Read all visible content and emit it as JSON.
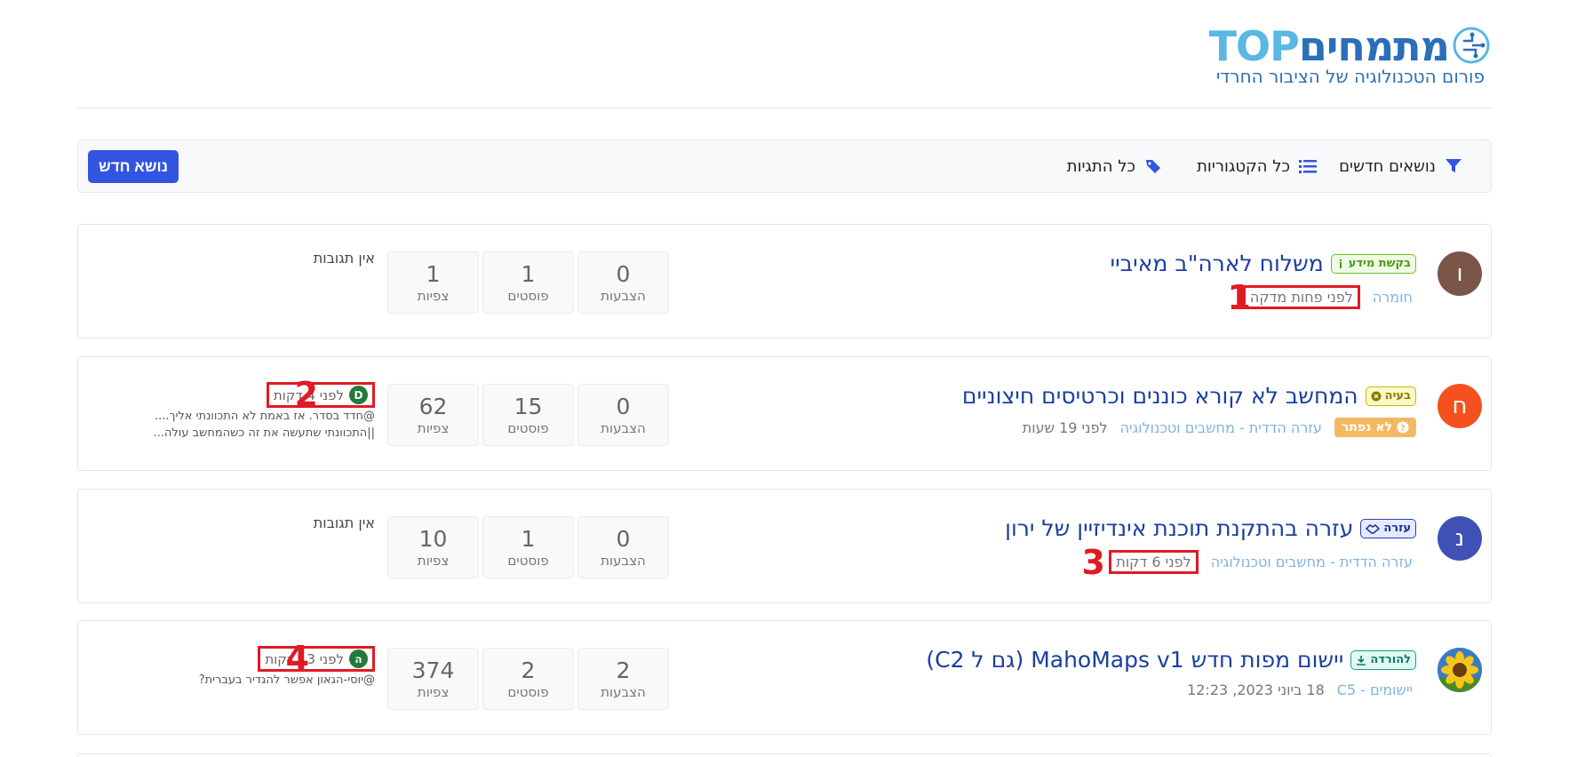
{
  "logo": {
    "main_heb": "מתמחים",
    "main_top": "TOP",
    "subtitle": "פורום הטכנולוגיה של הציבור החרדי"
  },
  "toolbar": {
    "new_topics": "נושאים חדשים",
    "all_categories": "כל הקטגוריות",
    "all_tags": "כל התגיות",
    "new_topic_button": "נושא חדש"
  },
  "stat_labels": {
    "votes": "הצבעות",
    "posts": "פוסטים",
    "views": "צפיות"
  },
  "topics": [
    {
      "avatar_letter": "ו",
      "avatar_color": "#7b5548",
      "badge": "בקשת מידע",
      "title": "משלוח לארה\"ב מאיביי",
      "category": "חומרה",
      "time": "לפני פחות מדקה",
      "votes": "0",
      "posts": "1",
      "views": "1",
      "no_replies": "אין תגובות",
      "marker": "1"
    },
    {
      "avatar_letter": "ח",
      "avatar_color": "#f4511e",
      "badge": "בעיה",
      "title": "המחשב לא קורא כוננים וכרטיסים חיצוניים",
      "status": "לא נפתר",
      "category": "עזרה הדדית - מחשבים וטכנולוגיה",
      "time": "לפני 19 שעות",
      "votes": "0",
      "posts": "15",
      "views": "62",
      "teaser_avatar": "D",
      "teaser_time": "לפני 4 דקות",
      "teaser_lines": [
        "@חדד בסדר. אז באמת לא התכוונתי אליך....",
        "||התכוונתי שתעשה את זה כשהמחשב עולה..."
      ],
      "marker": "2"
    },
    {
      "avatar_letter": "נ",
      "avatar_color": "#3f51b5",
      "badge": "עזרה",
      "title": "עזרה בהתקנת תוכנת אינדיזיין של ירון",
      "category": "עזרה הדדית - מחשבים וטכנולוגיה",
      "time": "לפני 6 דקות",
      "votes": "0",
      "posts": "1",
      "views": "10",
      "no_replies": "אין תגובות",
      "marker": "3"
    },
    {
      "avatar_color": "#2b6cb5",
      "badge": "להורדה",
      "title": "יישום מפות חדש MahoMaps v1 (גם ל C2)",
      "category": "יישומים - C5",
      "time": "18 ביוני 2023, 12:23",
      "votes": "2",
      "posts": "2",
      "views": "374",
      "teaser_avatar": "ה",
      "teaser_time": "לפני 13 דקות",
      "teaser_lines": [
        "@יוסי-הגאון אפשר להגדיר בעברית?"
      ],
      "marker": "4"
    }
  ]
}
